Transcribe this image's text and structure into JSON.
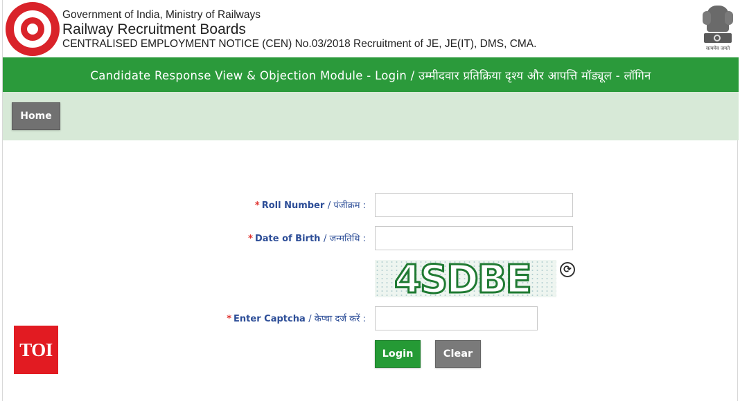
{
  "header": {
    "line1": "Government of India, Ministry of Railways",
    "line2": "Railway Recruitment Boards",
    "line3": "CENTRALISED EMPLOYMENT NOTICE (CEN) No.03/2018 Recruitment of JE, JE(IT), DMS, CMA.",
    "emblem_motto": "सत्यमेव जयते"
  },
  "titlebar": {
    "text": "Candidate Response View & Objection Module - Login / उम्मीदवार प्रतिक्रिया दृश्य और आपत्ति मॉड्यूल - लॉगिन"
  },
  "nav": {
    "home_label": "Home"
  },
  "form": {
    "required_mark": "*",
    "roll_number": {
      "label": "Roll Number",
      "hindi": "/ पंजीक्रम :",
      "value": ""
    },
    "dob": {
      "label": "Date of Birth",
      "hindi": "/ जन्मतिथि :",
      "value": ""
    },
    "captcha": {
      "code": "4SDBE",
      "refresh_symbol": "⟳",
      "label": "Enter Captcha",
      "hindi": "/ केप्चा दर्ज करें :",
      "value": ""
    },
    "login_label": "Login",
    "clear_label": "Clear"
  },
  "watermark": {
    "text": "TOI"
  },
  "colors": {
    "green_bar": "#2b9a3b",
    "nav_bg": "#d7e9d7",
    "label_blue": "#2c4d97",
    "required_red": "#e0332f",
    "login_green": "#259a35",
    "clear_gray": "#7a7a7a",
    "toi_red": "#e21b22"
  }
}
